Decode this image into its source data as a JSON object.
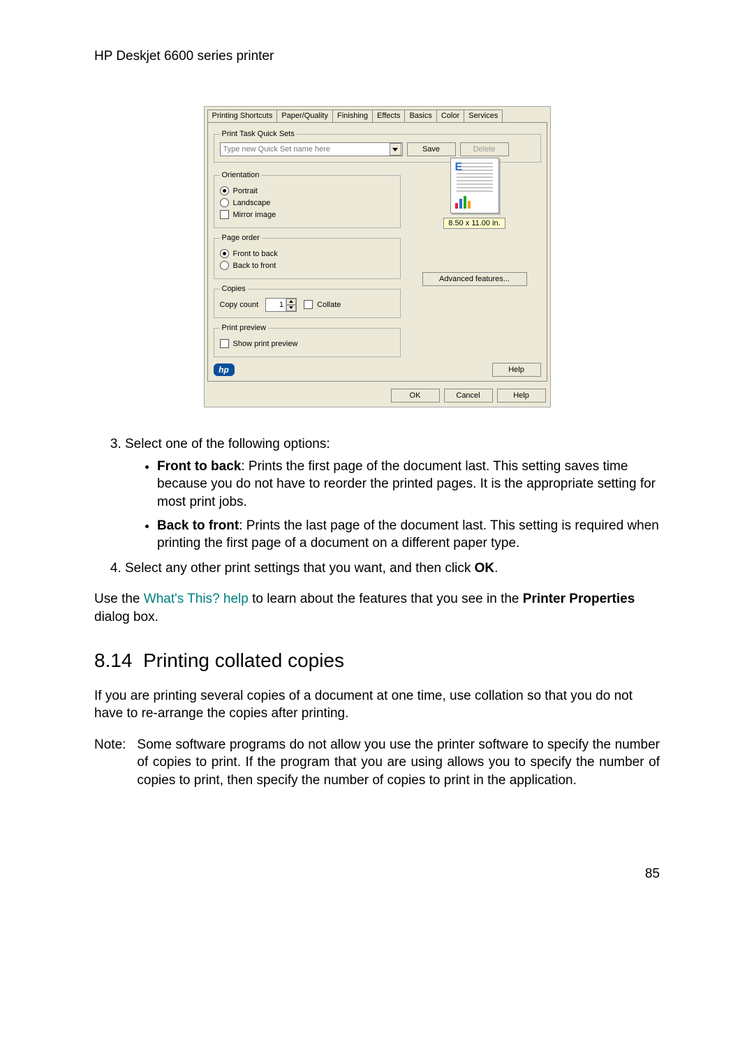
{
  "header": {
    "printer_name": "HP Deskjet 6600 series printer"
  },
  "dialog": {
    "tabs": [
      "Printing Shortcuts",
      "Paper/Quality",
      "Finishing",
      "Effects",
      "Basics",
      "Color",
      "Services"
    ],
    "active_tab_index": 4,
    "quicksets": {
      "legend": "Print Task Quick Sets",
      "placeholder": "Type new Quick Set name here",
      "save": "Save",
      "delete": "Delete"
    },
    "orientation": {
      "legend": "Orientation",
      "portrait": "Portrait",
      "landscape": "Landscape",
      "mirror": "Mirror image"
    },
    "page_order": {
      "legend": "Page order",
      "front_to_back": "Front to back",
      "back_to_front": "Back to front"
    },
    "copies": {
      "legend": "Copies",
      "label": "Copy count",
      "value": "1",
      "collate": "Collate"
    },
    "preview": {
      "legend": "Print preview",
      "show": "Show print preview"
    },
    "right": {
      "dimensions": "8.50 x 11.00 in.",
      "advanced": "Advanced features..."
    },
    "help_inner": "Help",
    "footer": {
      "ok": "OK",
      "cancel": "Cancel",
      "help": "Help"
    },
    "hp_logo": "hp"
  },
  "instructions": {
    "step3": "Select one of the following options:",
    "front_label": "Front to back",
    "front_text": ": Prints the first page of the document last. This setting saves time because you do not have to reorder the printed pages. It is the appropriate setting for most print jobs.",
    "back_label": "Back to front",
    "back_text": ": Prints the last page of the document last. This setting is required when printing the first page of a document on a different paper type.",
    "step4_pre": "Select any other print settings that you want, and then click ",
    "step4_ok": "OK",
    "step4_post": ".",
    "whats_pre": "Use the ",
    "whats_link": "What's This? help",
    "whats_mid": " to learn about the features that you see in the ",
    "whats_bold": "Printer Properties",
    "whats_post": " dialog box."
  },
  "section": {
    "number": "8.14",
    "title": "Printing collated copies",
    "intro": "If you are printing several copies of a document at one time, use collation so that you do not have to re-arrange the copies after printing.",
    "note_label": "Note:",
    "note_body": "Some software programs do not allow you use the printer software to specify the number of copies to print. If the program that you are using allows you to specify the number of copies to print, then specify the number of copies to print in the application."
  },
  "page_number": "85"
}
